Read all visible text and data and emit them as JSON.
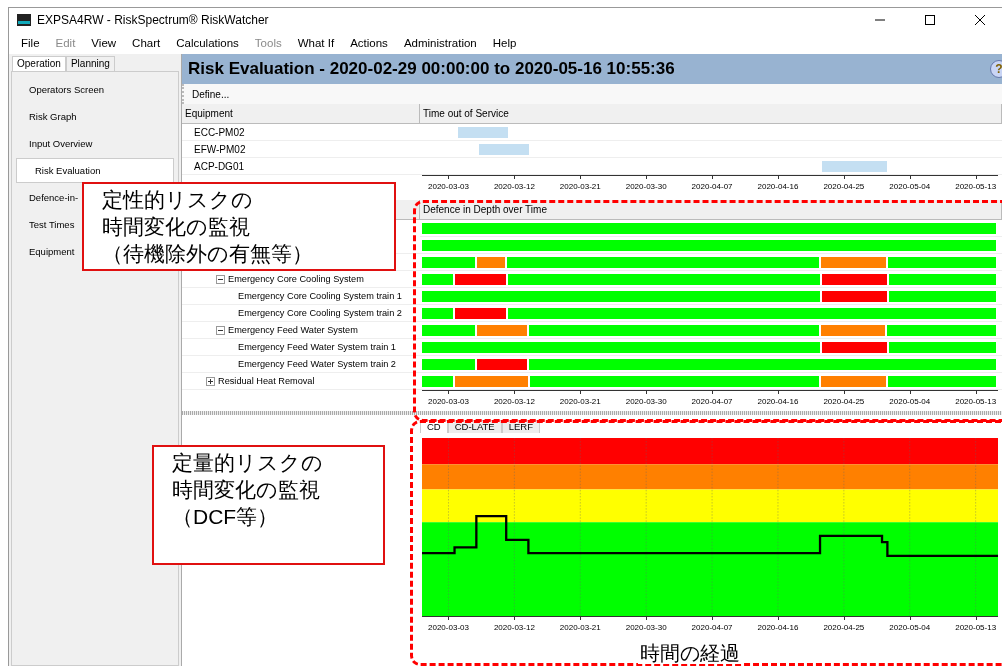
{
  "window": {
    "title": "EXPSA4RW - RiskSpectrum® RiskWatcher"
  },
  "menu": [
    {
      "label": "File",
      "disabled": false
    },
    {
      "label": "Edit",
      "disabled": true
    },
    {
      "label": "View",
      "disabled": false
    },
    {
      "label": "Chart",
      "disabled": false
    },
    {
      "label": "Calculations",
      "disabled": false
    },
    {
      "label": "Tools",
      "disabled": true
    },
    {
      "label": "What If",
      "disabled": false
    },
    {
      "label": "Actions",
      "disabled": false
    },
    {
      "label": "Administration",
      "disabled": false
    },
    {
      "label": "Help",
      "disabled": false
    }
  ],
  "sidebar": {
    "tabs": [
      {
        "label": "Operation",
        "selected": true
      },
      {
        "label": "Planning",
        "selected": false
      }
    ],
    "items": [
      {
        "label": "Operators Screen",
        "selected": false
      },
      {
        "label": "Risk Graph",
        "selected": false
      },
      {
        "label": "Input Overview",
        "selected": false
      },
      {
        "label": "Risk Evaluation",
        "selected": true
      },
      {
        "label": "Defence-in-",
        "selected": false
      },
      {
        "label": "Test Times",
        "selected": false
      },
      {
        "label": "Equipment",
        "selected": false
      }
    ]
  },
  "header": {
    "title": "Risk Evaluation - 2020-02-29 00:00:00 to 2020-05-16 10:55:36",
    "help": "?"
  },
  "toolbar": {
    "button": "Define..."
  },
  "equipment_table": {
    "columns": [
      "Equipment",
      "Time out of Service"
    ],
    "rows": [
      {
        "name": "ECC-PM02"
      },
      {
        "name": "EFW-PM02"
      },
      {
        "name": "ACP-DG01"
      }
    ],
    "axis_labels": [
      "2020-03-03",
      "2020-03-12",
      "2020-03-21",
      "2020-03-30",
      "2020-04-07",
      "2020-04-16",
      "2020-04-25",
      "2020-05-04",
      "2020-05-13"
    ]
  },
  "defence_table": {
    "timeline_header": "Defence in Depth over Time",
    "tree": [
      {
        "children": [
          {
            "children": [
              {
                "label": "Emergency Core Cooling System",
                "expanded": true,
                "children": [
                  {
                    "label": "Emergency Core Cooling System train 1"
                  },
                  {
                    "label": "Emergency Core Cooling System train 2"
                  }
                ]
              },
              {
                "label": "Emergency Feed Water System",
                "expanded": true,
                "children": [
                  {
                    "label": "Emergency Feed Water System train 1"
                  },
                  {
                    "label": "Emergency Feed Water System train 2"
                  }
                ]
              }
            ]
          },
          {
            "label": "Residual Heat Removal",
            "expanded": false
          }
        ]
      }
    ],
    "axis_labels": [
      "2020-03-03",
      "2020-03-12",
      "2020-03-21",
      "2020-03-30",
      "2020-04-07",
      "2020-04-16",
      "2020-04-25",
      "2020-05-04",
      "2020-05-13"
    ]
  },
  "risk_chart": {
    "tabs": [
      {
        "label": "CD",
        "selected": true
      },
      {
        "label": "CD-LATE",
        "selected": false
      },
      {
        "label": "LERF",
        "selected": false
      }
    ],
    "axis_labels": [
      "2020-03-03",
      "2020-03-12",
      "2020-03-21",
      "2020-03-30",
      "2020-04-07",
      "2020-04-16",
      "2020-04-25",
      "2020-05-04",
      "2020-05-13"
    ]
  },
  "annotations": [
    {
      "kind": "callout",
      "lines": [
        "定性的リスクの",
        "時間変化の監視",
        "（待機除外の有無等）"
      ]
    },
    {
      "kind": "callout",
      "lines": [
        "定量的リスクの",
        "時間変化の監視",
        "（DCF等）"
      ]
    },
    {
      "kind": "label",
      "lines": [
        "時間の経過"
      ]
    }
  ]
}
